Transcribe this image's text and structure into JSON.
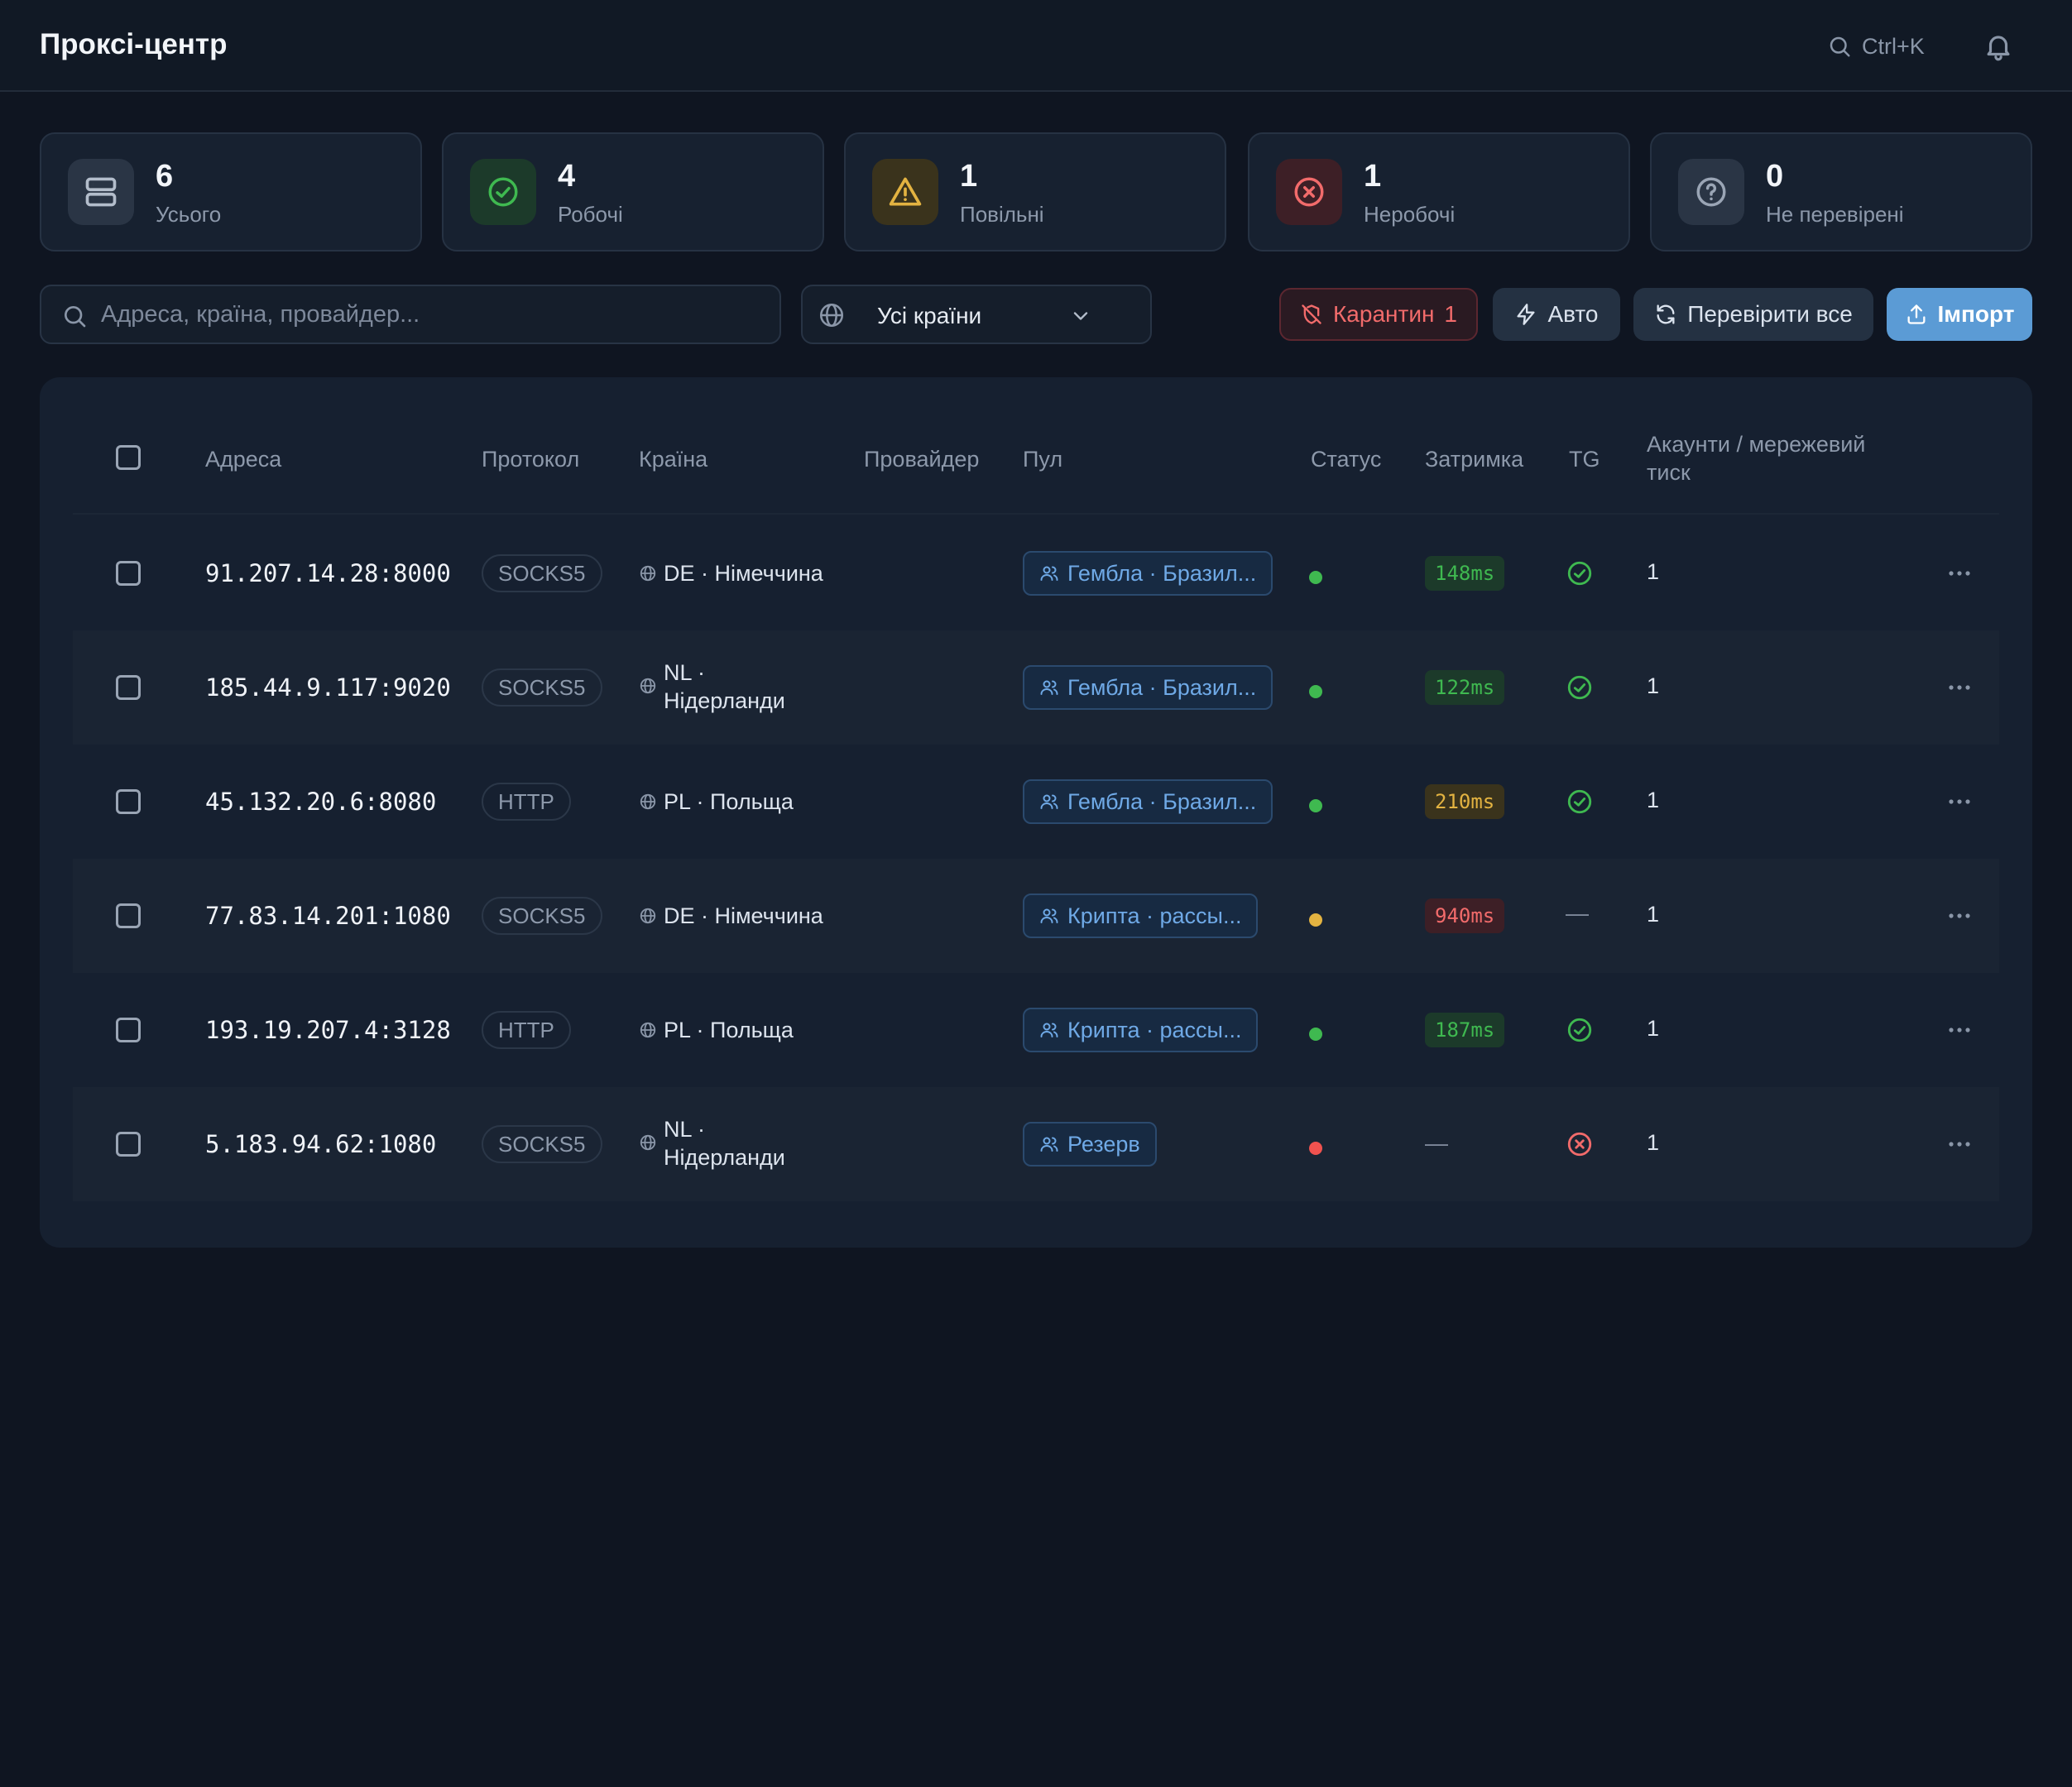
{
  "header": {
    "title": "Проксі-центр",
    "search_shortcut": "Ctrl+K",
    "icons": [
      "search-icon",
      "bell-icon"
    ]
  },
  "stats": [
    {
      "value": "6",
      "label": "Усього",
      "icon": "server-icon",
      "color": "#9aa5b5"
    },
    {
      "value": "4",
      "label": "Робочі",
      "icon": "check-circle-icon",
      "color": "#3fb950"
    },
    {
      "value": "1",
      "label": "Повільні",
      "icon": "warning-icon",
      "color": "#e3b341"
    },
    {
      "value": "1",
      "label": "Неробочі",
      "icon": "x-circle-icon",
      "color": "#f26b6b"
    },
    {
      "value": "0",
      "label": "Не перевірені",
      "icon": "question-circle-icon",
      "color": "#9aa5b5"
    }
  ],
  "toolbar": {
    "search_placeholder": "Адреса, країна, провайдер...",
    "country_filter": "Усі країни",
    "quarantine_label": "Карантин",
    "quarantine_count": "1",
    "auto_label": "Авто",
    "check_all_label": "Перевірити все",
    "import_label": "Імпорт"
  },
  "table": {
    "columns": {
      "address": "Адреса",
      "protocol": "Протокол",
      "country": "Країна",
      "provider": "Провайдер",
      "pool": "Пул",
      "status": "Статус",
      "latency": "Затримка",
      "tg": "TG",
      "accounts_1": "Акаунти / мережевий",
      "accounts_2": "тиск"
    },
    "rows": [
      {
        "address": "91.207.14.28:8000",
        "protocol": "SOCKS5",
        "country_1": "DE · Німеччина",
        "country_2": "",
        "provider": "",
        "pool": "Гембла · Бразил...",
        "status": "ok",
        "latency": "148ms",
        "latency_level": "good",
        "tg": "ok",
        "accounts": "1"
      },
      {
        "address": "185.44.9.117:9020",
        "protocol": "SOCKS5",
        "country_1": "NL ·",
        "country_2": "Нідерланди",
        "provider": "",
        "pool": "Гембла · Бразил...",
        "status": "ok",
        "latency": "122ms",
        "latency_level": "good",
        "tg": "ok",
        "accounts": "1"
      },
      {
        "address": "45.132.20.6:8080",
        "protocol": "HTTP",
        "country_1": "PL · Польща",
        "country_2": "",
        "provider": "",
        "pool": "Гембла · Бразил...",
        "status": "ok",
        "latency": "210ms",
        "latency_level": "medium",
        "tg": "ok",
        "accounts": "1"
      },
      {
        "address": "77.83.14.201:1080",
        "protocol": "SOCKS5",
        "country_1": "DE · Німеччина",
        "country_2": "",
        "provider": "",
        "pool": "Крипта · рассы...",
        "status": "slow",
        "latency": "940ms",
        "latency_level": "bad",
        "tg": "none",
        "accounts": "1"
      },
      {
        "address": "193.19.207.4:3128",
        "protocol": "HTTP",
        "country_1": "PL · Польща",
        "country_2": "",
        "provider": "",
        "pool": "Крипта · рассы...",
        "status": "ok",
        "latency": "187ms",
        "latency_level": "good",
        "tg": "ok",
        "accounts": "1"
      },
      {
        "address": "5.183.94.62:1080",
        "protocol": "SOCKS5",
        "country_1": "NL ·",
        "country_2": "Нідерланди",
        "provider": "",
        "pool": "Резерв",
        "status": "dead",
        "latency": "—",
        "latency_level": "none",
        "tg": "fail",
        "accounts": "1"
      }
    ]
  },
  "colors": {
    "ok": "#3fb950",
    "slow": "#e3b341",
    "dead": "#f0524f",
    "accent": "#5b9bd5"
  }
}
